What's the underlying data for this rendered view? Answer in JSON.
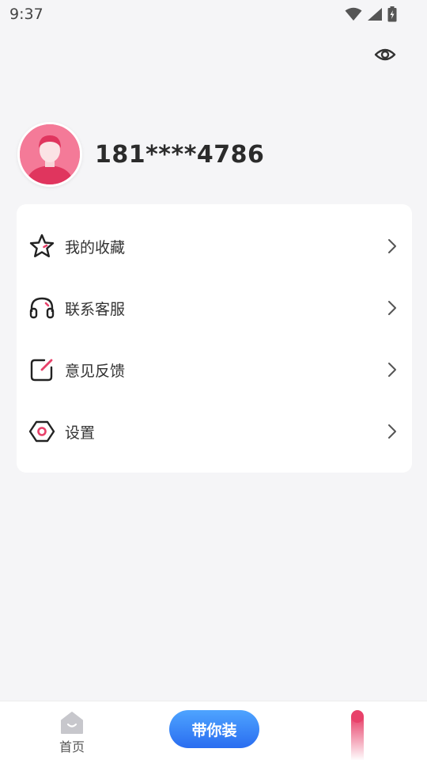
{
  "status_bar": {
    "time": "9:37",
    "icons": [
      "wifi-icon",
      "signal-icon",
      "battery-charging-icon"
    ]
  },
  "header": {
    "visibility_icon": "eye-icon"
  },
  "profile": {
    "avatar_icon": "user-avatar",
    "phone": "181****4786"
  },
  "menu": {
    "items": [
      {
        "label": "我的收藏",
        "icon": "star-icon"
      },
      {
        "label": "联系客服",
        "icon": "headset-icon"
      },
      {
        "label": "意见反馈",
        "icon": "edit-feedback-icon"
      },
      {
        "label": "设置",
        "icon": "settings-hexagon-icon"
      }
    ]
  },
  "bottom_nav": {
    "home_label": "首页",
    "center_button_label": "带你装",
    "accent_color": "#e8416a",
    "button_color": "#2f7bf5"
  }
}
